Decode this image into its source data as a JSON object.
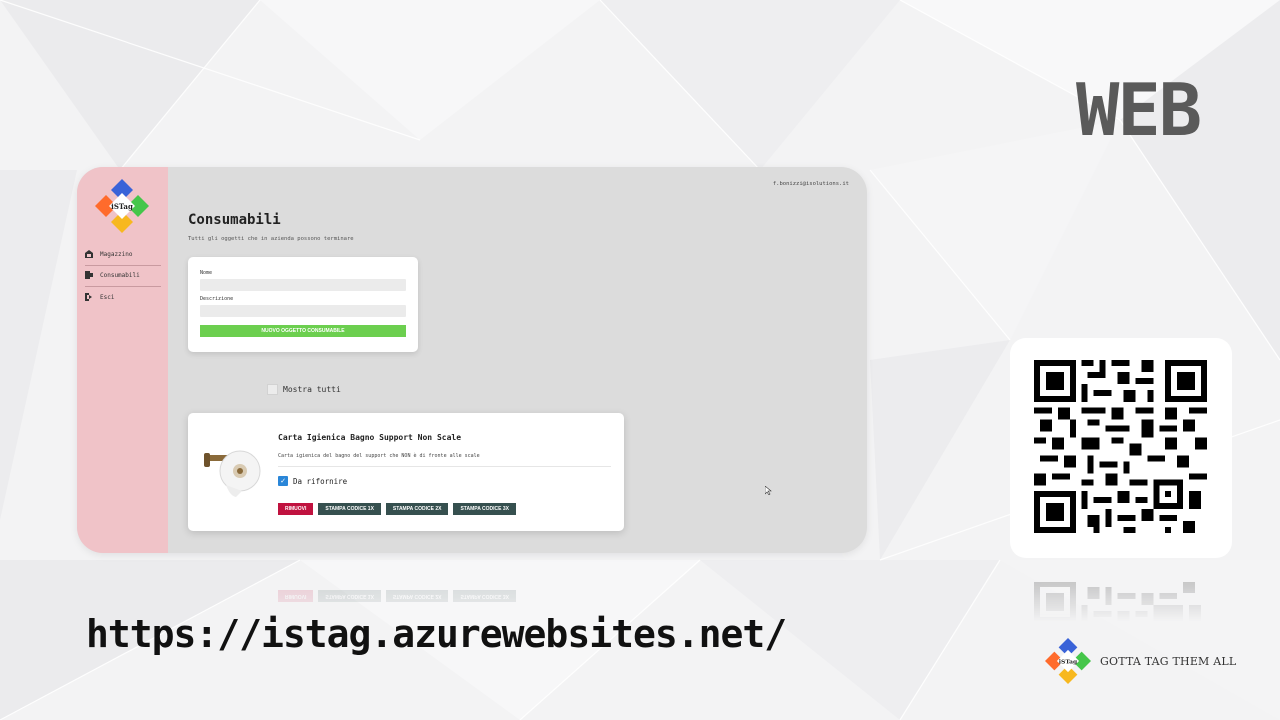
{
  "banner": {
    "heading": "WEB",
    "url": "https://istag.azurewebsites.net/",
    "tagline": "GOTTA TAG THEM ALL",
    "logo_text": "iSTag"
  },
  "app": {
    "user_email": "f.bonizzi@isolutions.it",
    "sidebar": {
      "items": [
        {
          "label": "Magazzino",
          "icon": "warehouse-icon"
        },
        {
          "label": "Consumabili",
          "icon": "consumables-icon"
        },
        {
          "label": "Esci",
          "icon": "logout-icon"
        }
      ]
    },
    "page": {
      "title": "Consumabili",
      "subtitle": "Tutti gli oggetti che in azienda possono terminare"
    },
    "form": {
      "name_label": "Nome",
      "name_value": "",
      "description_label": "Descrizione",
      "description_value": "",
      "submit_label": "NUOVO OGGETTO CONSUMABILE"
    },
    "show_all": {
      "label": "Mostra tutti",
      "checked": false
    },
    "item": {
      "title": "Carta Igienica Bagno Support Non Scale",
      "description": "Carta igienica del bagno del support che NON è di fronte alle scale",
      "restock_label": "Da rifornire",
      "restock_checked": true,
      "buttons": {
        "remove": "RIMUOVI",
        "print_1x": "STAMPA CODICE 1X",
        "print_2x": "STAMPA CODICE 2X",
        "print_3x": "STAMPA CODICE 3X"
      }
    }
  },
  "colors": {
    "sidebar_bg": "#f0c3c8",
    "content_bg": "#dcdcdc",
    "green_button": "#6ccf4f",
    "remove_button": "#c0123f",
    "print_button": "#36504f",
    "checkbox": "#2a86d8"
  }
}
